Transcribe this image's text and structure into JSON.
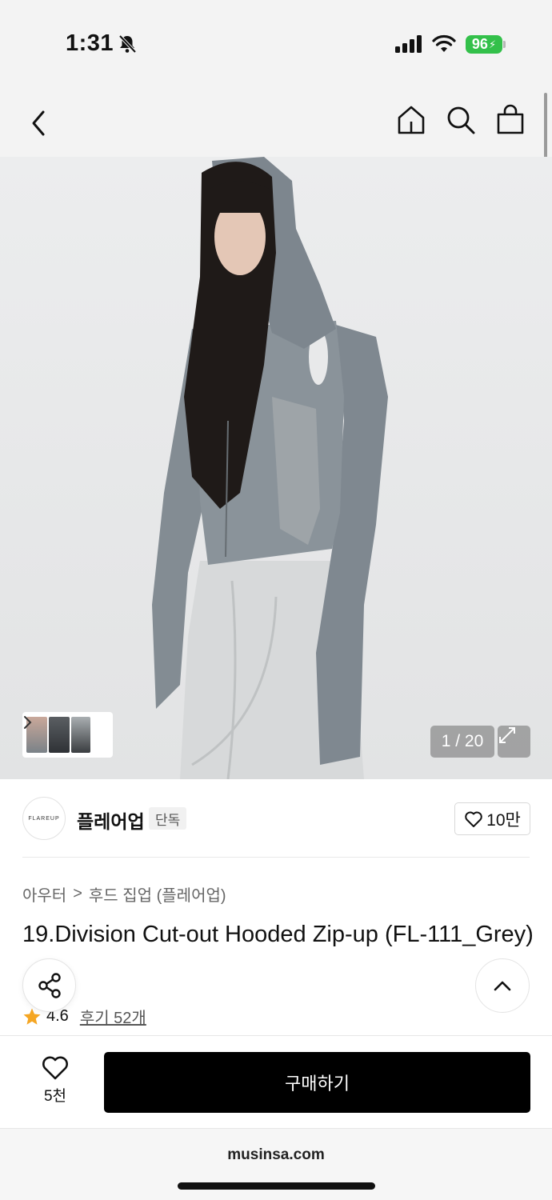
{
  "status": {
    "time": "1:31",
    "battery": "96"
  },
  "nav": {
    "back_icon": "chevron-left-icon",
    "home_icon": "home-icon",
    "search_icon": "search-icon",
    "bag_icon": "shopping-bag-icon"
  },
  "gallery": {
    "counter": "1 / 20",
    "current": 1,
    "total": 20
  },
  "brand": {
    "logo_text": "FLAREUP",
    "name": "플레어업",
    "badge": "단독",
    "likes": "10만"
  },
  "breadcrumb": {
    "category": "아우터",
    "separator": ">",
    "subcategory": "후드 집업 (플레어업)"
  },
  "product": {
    "title": "19.Division Cut-out Hooded Zip-up (FL-111_Grey)",
    "rating": "4.6",
    "reviews": "후기 52개"
  },
  "bottom": {
    "wish_count": "5천",
    "buy_label": "구매하기"
  },
  "browser": {
    "url": "musinsa.com"
  },
  "colors": {
    "accent_battery": "#33c04a",
    "star": "#f5a623",
    "buy_button": "#000000"
  }
}
